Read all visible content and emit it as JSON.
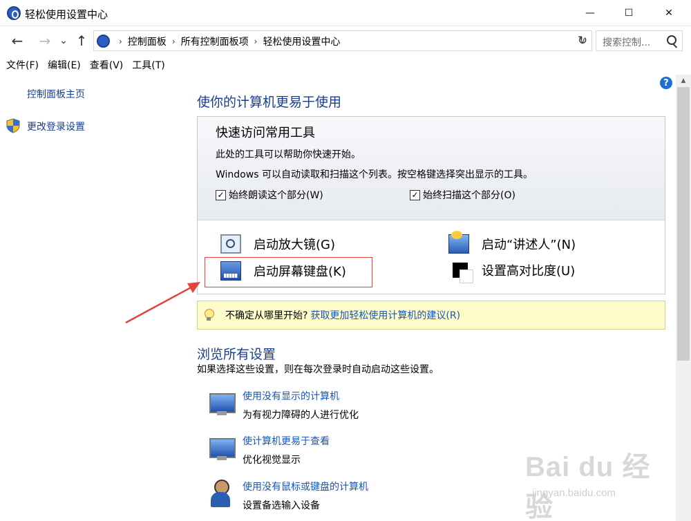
{
  "window": {
    "title": "轻松使用设置中心",
    "minimize": "—",
    "maximize": "☐",
    "close": "✕"
  },
  "nav": {
    "back": "←",
    "forward": "→",
    "recent": "⌄",
    "up": "↑",
    "breadcrumbs": [
      "控制面板",
      "所有控制面板项",
      "轻松使用设置中心"
    ],
    "separator": "›",
    "dropdown": "∨",
    "refresh": "↻",
    "search_placeholder": "搜索控制..."
  },
  "menu": [
    "文件(F)",
    "编辑(E)",
    "查看(V)",
    "工具(T)"
  ],
  "left": {
    "home_link": "控制面板主页",
    "login_link": "更改登录设置"
  },
  "main": {
    "help": "?",
    "heading": "使你的计算机更易于使用",
    "quick": {
      "title": "快速访问常用工具",
      "line1": "此处的工具可以帮助你快速开始。",
      "line2": "Windows 可以自动读取和扫描这个列表。按空格键选择突出显示的工具。",
      "check_read": "始终朗读这个部分(W)",
      "check_scan": "始终扫描这个部分(O)",
      "checkmark": "✓",
      "tools": {
        "magnifier": "启动放大镜(G)",
        "narrator": "启动“讲述人”(N)",
        "keyboard": "启动屏幕键盘(K)",
        "contrast": "设置高对比度(U)"
      }
    },
    "tip": {
      "text": "不确定从哪里开始?",
      "link": "获取更加轻松使用计算机的建议(R)"
    },
    "browse": {
      "heading": "浏览所有设置",
      "desc": "如果选择这些设置，则在每次登录时自动启动这些设置。",
      "items": [
        {
          "link": "使用没有显示的计算机",
          "desc": "为有视力障碍的人进行优化",
          "icon": "monitor-speech-icon"
        },
        {
          "link": "使计算机更易于查看",
          "desc": "优化视觉显示",
          "icon": "monitor-magnifier-icon"
        },
        {
          "link": "使用没有鼠标或键盘的计算机",
          "desc": "设置备选输入设备",
          "icon": "person-icon"
        }
      ]
    }
  },
  "watermark": {
    "main": "Bai du 经验",
    "sub": "jingyan.baidu.com"
  },
  "colors": {
    "link": "#1a55b8",
    "heading": "#1a3e8e",
    "annotation": "#e2433c",
    "tip_bg": "#fdfbc8"
  }
}
